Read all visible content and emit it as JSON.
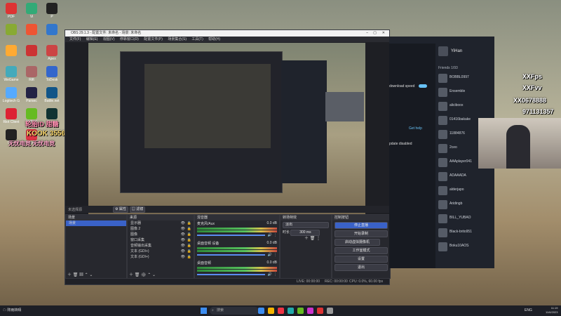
{
  "desktop": {
    "icons": [
      {
        "label": "PDF",
        "color": "#d33"
      },
      {
        "label": "Vi",
        "color": "#3a7"
      },
      {
        "label": "P",
        "color": "#222"
      },
      {
        "label": "",
        "color": "#8a3"
      },
      {
        "label": "",
        "color": "#e53"
      },
      {
        "label": "",
        "color": "#37c"
      },
      {
        "label": "",
        "color": "#fa3"
      },
      {
        "label": "",
        "color": "#c33"
      },
      {
        "label": "Apex",
        "color": "#c44"
      },
      {
        "label": "WeGame",
        "color": "#4ab"
      },
      {
        "label": "Rift",
        "color": "#a66"
      },
      {
        "label": "ToDesk",
        "color": "#36c"
      },
      {
        "label": "Logitech G",
        "color": "#5af"
      },
      {
        "label": "Parsec",
        "color": "#224"
      },
      {
        "label": "Battle.net",
        "color": "#158"
      },
      {
        "label": "Riot Client",
        "color": "#d23"
      },
      {
        "label": "NVIDIA",
        "color": "#6b2"
      },
      {
        "label": "Steam",
        "color": "#133"
      },
      {
        "label": "OBS",
        "color": "#222"
      },
      {
        "label": "Valorant",
        "color": "#d34"
      }
    ]
  },
  "overlay": {
    "left_top": "轮胎ID 甜糖",
    "left_kook": "KOOK 355666",
    "left_bottom": "无忧电竞 无忧电竞",
    "right_fps": "XXFps",
    "right_fvv": "XXFvv",
    "right_wx": "XX0678888",
    "right_qq": "971131357"
  },
  "obs": {
    "title": "OBS 29.1.3 - 配置文件: 未命名 - 场景: 未命名",
    "menu": [
      "文件(F)",
      "编辑(E)",
      "视图(V)",
      "停靠窗口(D)",
      "配置文件(P)",
      "场景集合(S)",
      "工具(T)",
      "帮助(H)"
    ],
    "context_bar": {
      "none_selected": "未选择源",
      "properties": "属性",
      "filters": "滤镜"
    },
    "scenes": {
      "header": "场景",
      "items": [
        "场景"
      ]
    },
    "sources": {
      "header": "来源",
      "items": [
        "显示器",
        "图像 2",
        "图像",
        "窗口采集",
        "音频输出采集",
        "文本 (GDI+)",
        "文本 (GDI+)"
      ]
    },
    "mixer": {
      "header": "混音器",
      "channels": [
        {
          "name": "麦克风/Aux",
          "db": "0.0 dB"
        },
        {
          "name": "桌面音频 设备",
          "db": "0.0 dB"
        },
        {
          "name": "桌面音频",
          "db": "0.0 dB"
        }
      ]
    },
    "transitions": {
      "header": "转场特效",
      "type": "淡出",
      "duration_label": "时长",
      "duration": "300 ms"
    },
    "controls": {
      "header": "控制按钮",
      "buttons": [
        "停止直播",
        "开始录制",
        "启动虚拟摄像机",
        "工作室模式",
        "设置",
        "退出"
      ]
    },
    "status": {
      "live": "LIVE: 00:00:00",
      "rec": "REC: 00:00:00",
      "cpu": "CPU: 0.0%, 60.00 fps"
    }
  },
  "steam": {
    "user": "YiHan",
    "download_speed_label": "download speed",
    "update_label": "pdate disabled",
    "help_link": "Get help",
    "friends_header": "Friends",
    "friends_count": "1/93",
    "friends": [
      "BOBBL0997",
      "Ensemble",
      "aliciboox",
      "01416bakake",
      "11884876",
      "2ceo",
      "AAAplayer041",
      "ADAAADA",
      "alderjapo",
      "Aridingb",
      "BILL_YUBAO",
      "Black-brito951",
      "Boku10AOS"
    ]
  },
  "taskbar": {
    "search_placeholder": "搜索",
    "weather": "阵雨转晴",
    "time": "11:19",
    "date": "11/6/2023",
    "lang": "ENG"
  },
  "colors": {
    "obs_accent": "#3a62c8",
    "steam_bg": "#1f232c",
    "taskbar": "#1d1f26"
  }
}
